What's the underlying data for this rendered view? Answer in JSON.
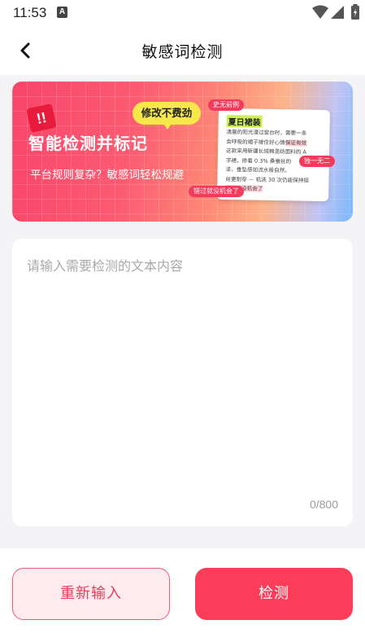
{
  "status_bar": {
    "time": "11:53",
    "notification_letter": "A"
  },
  "header": {
    "title": "敏感词检测",
    "back_icon": "chevron-left-icon"
  },
  "banner": {
    "headline": "智能检测并标记",
    "subline": "平台规则复杂？敏感词轻松规避",
    "bubble": "修改不费劲",
    "exclaim": "!!",
    "tag_top": "史无前例",
    "tag_side": "独一无二",
    "tag_bottom": "错过就没机会了",
    "card_title": "夏日裙装",
    "card_line1": "清晨的阳光漫过窗台时，需要一条",
    "card_line2": "会呼吸的裙子接住好心情",
    "card_hl1": "保证有效",
    "card_line3": "这款采用新疆长绒棉混纺面料的 A",
    "card_line4": "字裙，掺着 0.3% 桑蚕丝的",
    "card_line5": "泽，垂坠感如流水般自然，",
    "card_line6": "丝更耐穿 — 机洗 30 次仍能保持挺",
    "card_hl2": "错过就没机会了"
  },
  "editor": {
    "placeholder": "请输入需要检测的文本内容",
    "value": "",
    "counter": "0/800"
  },
  "actions": {
    "reset_label": "重新输入",
    "detect_label": "检测"
  },
  "colors": {
    "accent": "#fc3d5a",
    "accent_light": "#fdebef",
    "banner_yellow": "#f6e84a"
  }
}
